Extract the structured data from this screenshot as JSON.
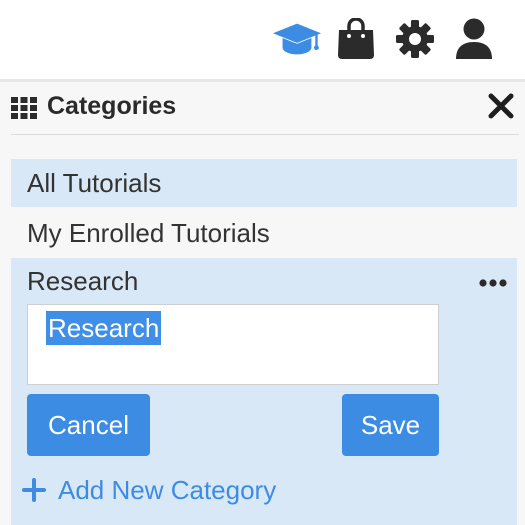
{
  "toolbar": {
    "icons": [
      "graduation-cap-icon",
      "shopping-bag-icon",
      "gear-icon",
      "user-icon"
    ],
    "accent_color": "#3d8ce4",
    "icon_color": "#2b2b2b"
  },
  "panel": {
    "title": "Categories",
    "title_icon": "grid-icon",
    "close_icon": "close-icon"
  },
  "categories": [
    {
      "label": "All Tutorials",
      "selected": true
    },
    {
      "label": "My Enrolled Tutorials",
      "selected": false
    },
    {
      "label": "Research",
      "selected": true,
      "editing": true
    }
  ],
  "editor": {
    "input_value": "Research",
    "cancel_label": "Cancel",
    "save_label": "Save",
    "more_icon": "more-horizontal-icon"
  },
  "add_category": {
    "label": "Add New Category",
    "icon": "plus-icon"
  },
  "colors": {
    "selected_row": "#d9e8f7",
    "panel_bg": "#f7f7f7",
    "primary_button": "#3d8ce4",
    "text_selection": "#3f8ee8"
  }
}
